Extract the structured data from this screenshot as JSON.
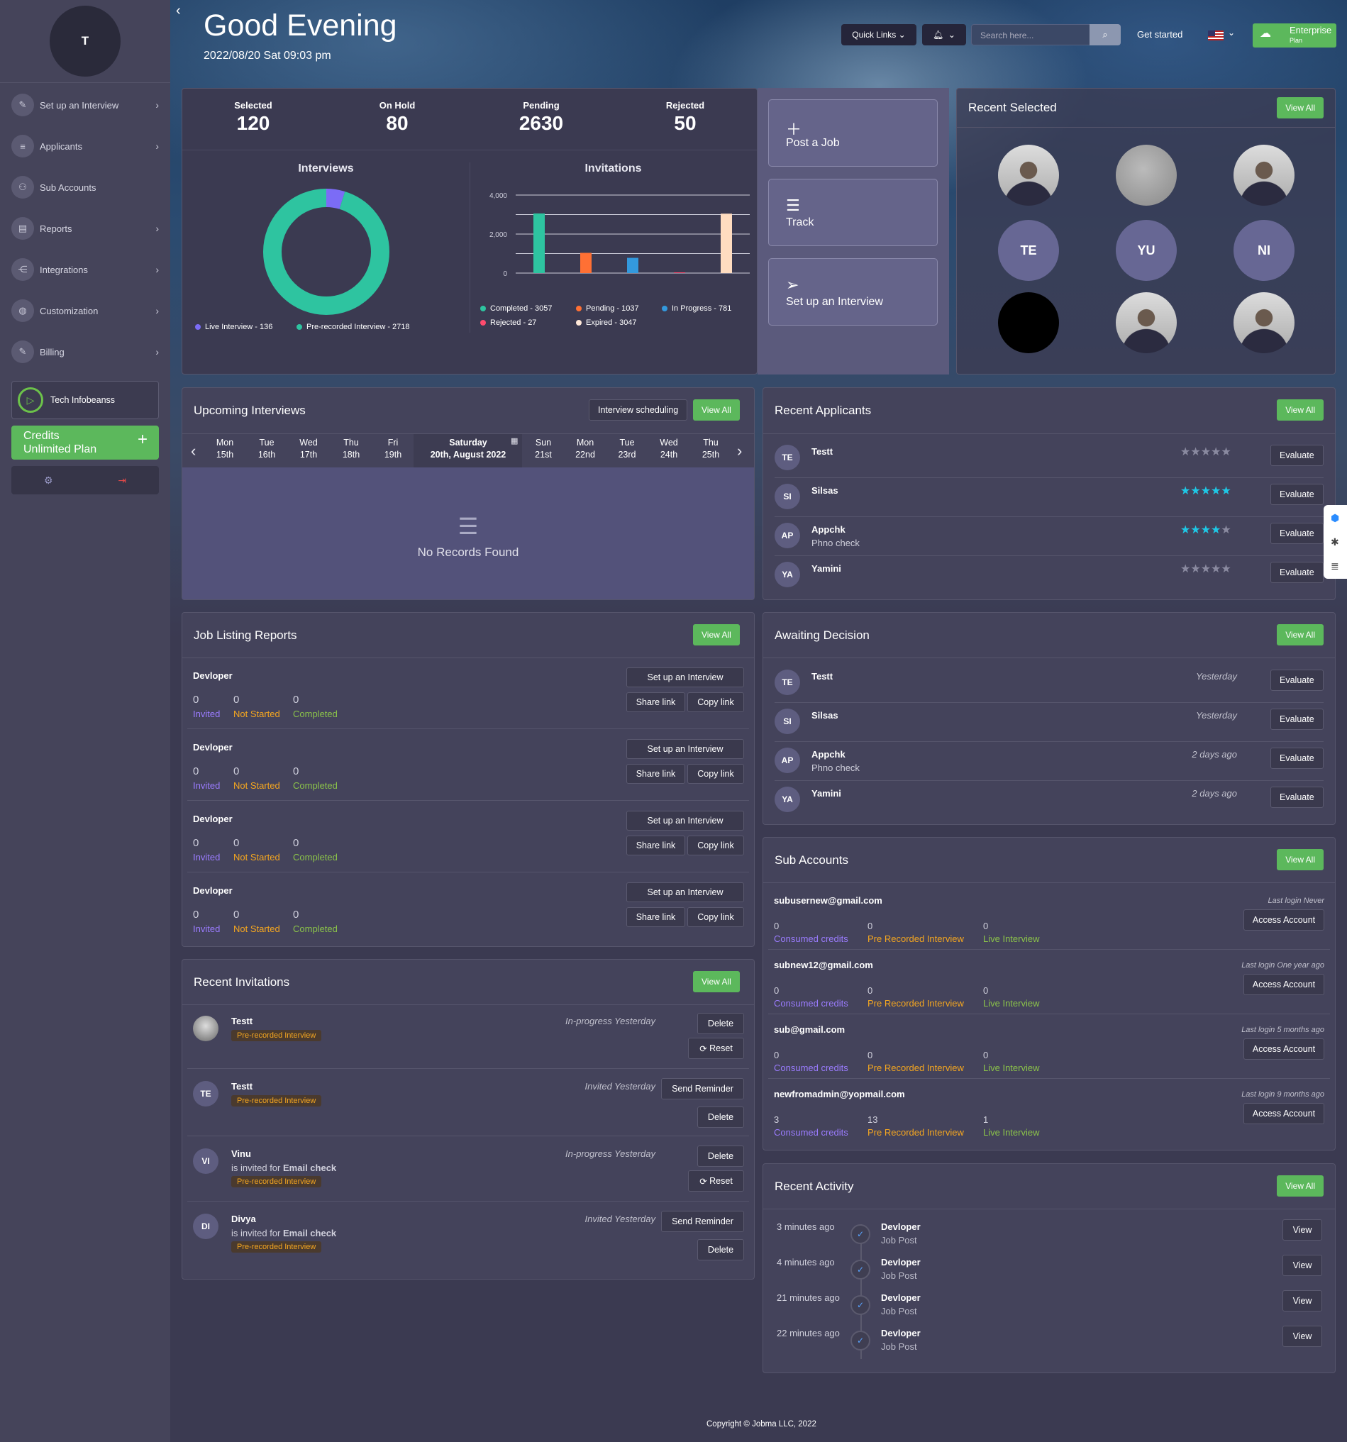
{
  "header": {
    "greeting": "Good Evening",
    "datetime": "2022/08/20 Sat 09:03 pm",
    "quick_links": "Quick Links",
    "search_placeholder": "Search here...",
    "get_started": "Get started",
    "plan_name": "Enterprise",
    "plan_sub": "Plan"
  },
  "sidebar": {
    "avatar_initial": "T",
    "items": [
      {
        "label": "Set up an Interview"
      },
      {
        "label": "Applicants"
      },
      {
        "label": "Sub Accounts"
      },
      {
        "label": "Reports"
      },
      {
        "label": "Integrations"
      },
      {
        "label": "Customization"
      },
      {
        "label": "Billing"
      }
    ],
    "company": "Tech Infobeanss",
    "credits_label": "Credits",
    "credits_plan": "Unlimited Plan"
  },
  "stats": [
    {
      "label": "Selected",
      "value": "120"
    },
    {
      "label": "On Hold",
      "value": "80"
    },
    {
      "label": "Pending",
      "value": "2630"
    },
    {
      "label": "Rejected",
      "value": "50"
    }
  ],
  "interviews_chart": {
    "title": "Interviews",
    "legend": [
      "Live Interview - 136",
      "Pre-recorded Interview - 2718"
    ]
  },
  "invitations_chart": {
    "title": "Invitations",
    "legend": [
      "Completed - 3057",
      "Pending - 1037",
      "In Progress - 781",
      "Rejected - 27",
      "Expired - 3047"
    ]
  },
  "chart_data": [
    {
      "type": "pie",
      "title": "Interviews",
      "categories": [
        "Live Interview",
        "Pre-recorded Interview"
      ],
      "values": [
        136,
        2718
      ],
      "colors": [
        "#7b6cf6",
        "#2ec4a0"
      ]
    },
    {
      "type": "bar",
      "title": "Invitations",
      "categories": [
        "Completed",
        "Pending",
        "In Progress",
        "Rejected",
        "Expired"
      ],
      "values": [
        3057,
        1037,
        781,
        27,
        3047
      ],
      "colors": [
        "#2ec4a0",
        "#ff7034",
        "#3399dd",
        "#ff4b6e",
        "#ffdcc0"
      ],
      "ylim": [
        0,
        4000
      ],
      "yticks": [
        "4,000",
        "2,000",
        "0"
      ]
    }
  ],
  "actions": [
    {
      "label": "Post a Job"
    },
    {
      "label": "Track"
    },
    {
      "label": "Set up an Interview"
    }
  ],
  "recent_selected": {
    "title": "Recent Selected",
    "view_all": "View All",
    "initials": [
      "TE",
      "YU",
      "NI"
    ]
  },
  "upcoming": {
    "title": "Upcoming Interviews",
    "scheduling": "Interview scheduling",
    "view_all": "View All",
    "days": [
      {
        "d": "Mon",
        "n": "15th"
      },
      {
        "d": "Tue",
        "n": "16th"
      },
      {
        "d": "Wed",
        "n": "17th"
      },
      {
        "d": "Thu",
        "n": "18th"
      },
      {
        "d": "Fri",
        "n": "19th"
      },
      {
        "d": "Saturday",
        "n": "20th, August 2022"
      },
      {
        "d": "Sun",
        "n": "21st"
      },
      {
        "d": "Mon",
        "n": "22nd"
      },
      {
        "d": "Tue",
        "n": "23rd"
      },
      {
        "d": "Wed",
        "n": "24th"
      },
      {
        "d": "Thu",
        "n": "25th"
      }
    ],
    "empty": "No Records Found"
  },
  "recent_applicants": {
    "title": "Recent Applicants",
    "view_all": "View All",
    "evaluate": "Evaluate",
    "rows": [
      {
        "i": "TE",
        "name": "Testt",
        "sub": "",
        "rating": 0
      },
      {
        "i": "SI",
        "name": "Silsas",
        "sub": "",
        "rating": 5
      },
      {
        "i": "AP",
        "name": "Appchk",
        "sub": "Phno check",
        "rating": 4
      },
      {
        "i": "YA",
        "name": "Yamini",
        "sub": "",
        "rating": 0
      }
    ]
  },
  "job_reports": {
    "title": "Job Listing Reports",
    "view_all": "View All",
    "setup": "Set up an Interview",
    "share": "Share link",
    "copy": "Copy link",
    "invited": "Invited",
    "not_started": "Not Started",
    "completed": "Completed",
    "rows": [
      {
        "title": "Devloper",
        "invited": "0",
        "not_started": "0",
        "completed": "0"
      },
      {
        "title": "Devloper",
        "invited": "0",
        "not_started": "0",
        "completed": "0"
      },
      {
        "title": "Devloper",
        "invited": "0",
        "not_started": "0",
        "completed": "0"
      },
      {
        "title": "Devloper",
        "invited": "0",
        "not_started": "0",
        "completed": "0"
      }
    ]
  },
  "awaiting": {
    "title": "Awaiting Decision",
    "view_all": "View All",
    "evaluate": "Evaluate",
    "rows": [
      {
        "i": "TE",
        "name": "Testt",
        "sub": "",
        "time": "Yesterday"
      },
      {
        "i": "SI",
        "name": "Silsas",
        "sub": "",
        "time": "Yesterday"
      },
      {
        "i": "AP",
        "name": "Appchk",
        "sub": "Phno check",
        "time": "2 days ago"
      },
      {
        "i": "YA",
        "name": "Yamini",
        "sub": "",
        "time": "2 days ago"
      }
    ]
  },
  "sub_accounts": {
    "title": "Sub Accounts",
    "view_all": "View All",
    "access": "Access Account",
    "l1": "Consumed credits",
    "l2": "Pre Recorded Interview",
    "l3": "Live Interview",
    "rows": [
      {
        "email": "subusernew@gmail.com",
        "login": "Last login Never",
        "a": "0",
        "b": "0",
        "c": "0"
      },
      {
        "email": "subnew12@gmail.com",
        "login": "Last login One year ago",
        "a": "0",
        "b": "0",
        "c": "0"
      },
      {
        "email": "sub@gmail.com",
        "login": "Last login 5 months ago",
        "a": "0",
        "b": "0",
        "c": "0"
      },
      {
        "email": "newfromadmin@yopmail.com",
        "login": "Last login 9 months ago",
        "a": "3",
        "b": "13",
        "c": "1"
      }
    ]
  },
  "recent_invitations": {
    "title": "Recent Invitations",
    "view_all": "View All",
    "badge": "Pre-recorded Interview",
    "delete": "Delete",
    "reset": "Reset",
    "reminder": "Send Reminder",
    "is_invited": "is invited for",
    "rows": [
      {
        "i": "",
        "name": "Testt",
        "status": "In-progress Yesterday",
        "job": ""
      },
      {
        "i": "TE",
        "name": "Testt",
        "status": "Invited Yesterday",
        "job": ""
      },
      {
        "i": "VI",
        "name": "Vinu",
        "status": "In-progress Yesterday",
        "job": "Email check"
      },
      {
        "i": "DI",
        "name": "Divya",
        "status": "Invited Yesterday",
        "job": "Email check"
      }
    ]
  },
  "recent_activity": {
    "title": "Recent Activity",
    "view_all": "View All",
    "view": "View",
    "rows": [
      {
        "time": "3 minutes ago",
        "title": "Devloper",
        "sub": "Job Post"
      },
      {
        "time": "4 minutes ago",
        "title": "Devloper",
        "sub": "Job Post"
      },
      {
        "time": "21 minutes ago",
        "title": "Devloper",
        "sub": "Job Post"
      },
      {
        "time": "22 minutes ago",
        "title": "Devloper",
        "sub": "Job Post"
      }
    ]
  },
  "footer": "Copyright © Jobma LLC, 2022"
}
